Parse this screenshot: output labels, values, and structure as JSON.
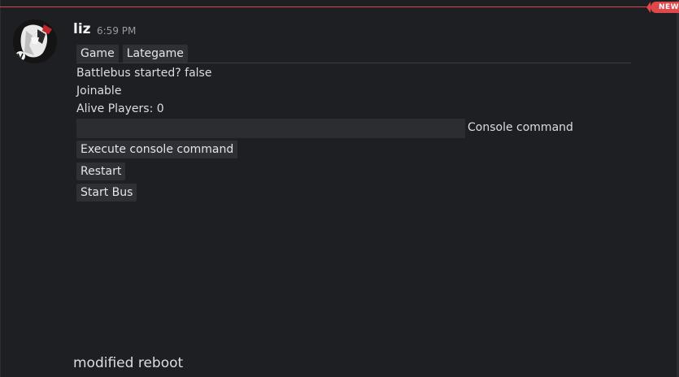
{
  "divider": {
    "new_label": "NEW"
  },
  "message": {
    "author": "liz",
    "timestamp": "6:59 PM"
  },
  "tabs": [
    {
      "label": "Game"
    },
    {
      "label": "Lategame"
    }
  ],
  "status": {
    "battlebus": "Battlebus started? false",
    "joinable": "Joinable",
    "alive_players": "Alive Players: 0"
  },
  "console": {
    "input_value": "",
    "label": "Console command"
  },
  "buttons": {
    "execute": "Execute console command",
    "restart": "Restart",
    "start_bus": "Start Bus"
  },
  "footer": {
    "text": "modified reboot"
  },
  "colors": {
    "background": "#1e1f22",
    "new_accent": "#e0474b",
    "button_bg": "#2e3035"
  }
}
